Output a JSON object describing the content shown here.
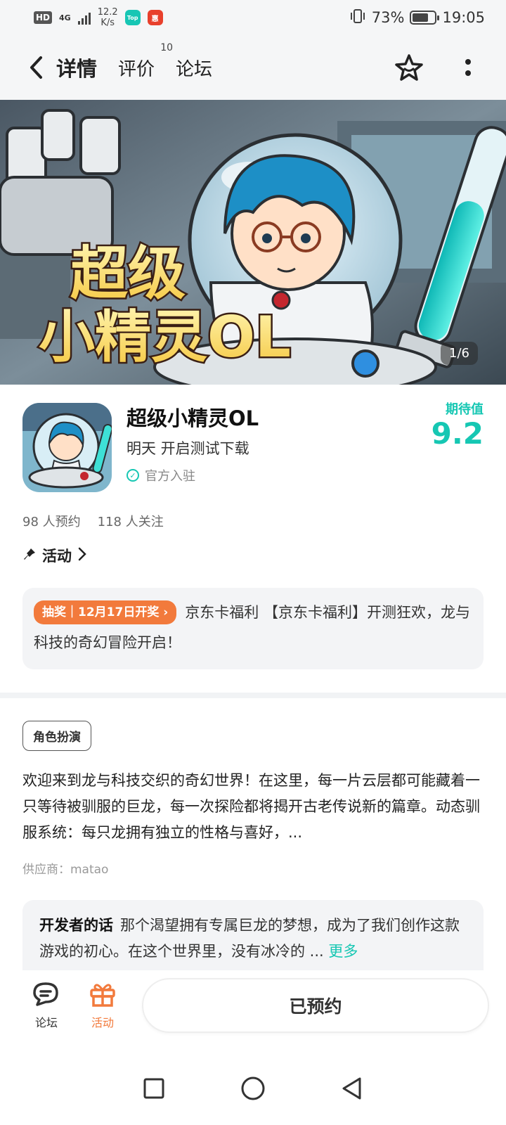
{
  "status_bar": {
    "hd": "HD",
    "network": "4G",
    "speed_value": "12.2",
    "speed_unit": "K/s",
    "app1": "Top",
    "app2": "惠",
    "battery": "73%",
    "time": "19:05",
    "battery_level": 0.73
  },
  "nav": {
    "tabs": [
      {
        "label": "详情",
        "badge": ""
      },
      {
        "label": "评价",
        "badge": "10"
      },
      {
        "label": "论坛",
        "badge": ""
      }
    ],
    "icons": [
      "back-icon",
      "favorite-star-icon",
      "more-dots-icon"
    ]
  },
  "banner": {
    "title_art": "超级小精灵OL",
    "counter": "1/6"
  },
  "app": {
    "name": "超级小精灵OL",
    "status": "明天 开启测试下载",
    "official": "官方入驻",
    "expect_label": "期待值",
    "expect_value": "9.2"
  },
  "stats": {
    "reservations": "98 人预约",
    "follows": "118 人关注"
  },
  "activity": {
    "title": "活动",
    "tag": "抽奖｜12月17日开奖",
    "text": "京东卡福利 【京东卡福利】开测狂欢，龙与科技的奇幻冒险开启！"
  },
  "description": {
    "genre": "角色扮演",
    "text": "欢迎来到龙与科技交织的奇幻世界！在这里，每一片云层都可能藏着一只等待被驯服的巨龙，每一次探险都将揭开古老传说新的篇章。动态驯服系统：每只龙拥有独立的性格与喜好，...",
    "supplier": "供应商：matao"
  },
  "developer": {
    "label": "开发者的话",
    "text": "那个渴望拥有专属巨龙的梦想，成为了我们创作这款游戏的初心。在这个世界里，没有冰冷的 ... ",
    "more": "更多"
  },
  "bottom_bar": {
    "forum": "论坛",
    "activity": "活动",
    "reserve": "已预约"
  },
  "colors": {
    "accent": "#16c7b3",
    "orange": "#f27a3c"
  }
}
